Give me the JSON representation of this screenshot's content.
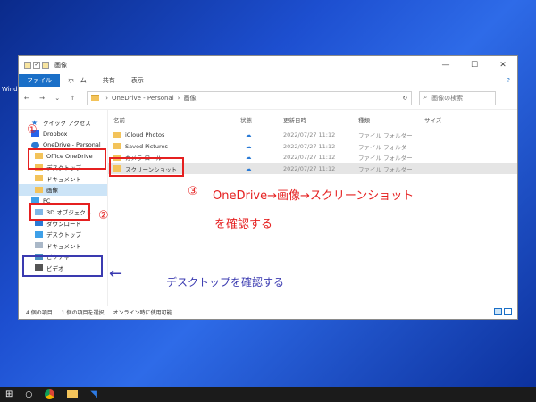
{
  "window": {
    "title": "画像",
    "controls": [
      "—",
      "☐",
      "✕"
    ]
  },
  "ribbon": {
    "tabs": [
      "ファイル",
      "ホーム",
      "共有",
      "表示"
    ],
    "help": "?"
  },
  "nav": {
    "back": "←",
    "forward": "→",
    "recent": "⌄",
    "up": "↑"
  },
  "address": {
    "segments": [
      "OneDrive - Personal",
      "画像"
    ],
    "separator": "›",
    "refresh": "↻"
  },
  "search": {
    "placeholder": "画像の検索",
    "icon": "⌕"
  },
  "sidebar": {
    "items": [
      {
        "label": "クイック アクセス",
        "icon": "star"
      },
      {
        "label": "Dropbox",
        "icon": "dropbox"
      },
      {
        "label": "OneDrive - Personal",
        "icon": "cloud"
      },
      {
        "label": "Office OneDrive",
        "icon": "folder"
      },
      {
        "label": "デスクトップ",
        "icon": "folder"
      },
      {
        "label": "ドキュメント",
        "icon": "folder"
      },
      {
        "label": "画像",
        "icon": "folder"
      },
      {
        "label": "PC",
        "icon": "pc"
      },
      {
        "label": "3D オブジェクト",
        "icon": "cube"
      },
      {
        "label": "ダウンロード",
        "icon": "download"
      },
      {
        "label": "デスクトップ",
        "icon": "desktop"
      },
      {
        "label": "ドキュメント",
        "icon": "doc"
      },
      {
        "label": "ピクチャ",
        "icon": "picture"
      },
      {
        "label": "ビデオ",
        "icon": "video"
      }
    ]
  },
  "columns": {
    "name": "名前",
    "status": "状態",
    "date": "更新日時",
    "type": "種類",
    "size": "サイズ"
  },
  "files": [
    {
      "name": "iCloud Photos",
      "status": "☁",
      "date": "2022/07/27 11:12",
      "type": "ファイル フォルダー"
    },
    {
      "name": "Saved Pictures",
      "status": "☁",
      "date": "2022/07/27 11:12",
      "type": "ファイル フォルダー"
    },
    {
      "name": "カメラ ロール",
      "status": "☁",
      "date": "2022/07/27 11:12",
      "type": "ファイル フォルダー"
    },
    {
      "name": "スクリーンショット",
      "status": "☁",
      "date": "2022/07/27 11:12",
      "type": "ファイル フォルダー"
    }
  ],
  "statusbar": {
    "count": "4 個の項目",
    "selected": "1 個の項目を選択",
    "availability": "オンライン時に使用可能"
  },
  "annotations": {
    "num1": "①",
    "num2": "②",
    "num3": "③",
    "instruction_line1": "OneDrive→画像→スクリーンショット",
    "instruction_line2": "を確認する",
    "desktop_arrow": "←",
    "desktop_note": "デスクトップを確認する"
  },
  "desktop": {
    "icon_label": "Windo"
  },
  "taskbar": {
    "start": "⊞",
    "search": "○"
  },
  "colors": {
    "accent": "#1a6fc7",
    "annotation_red": "#e52020",
    "annotation_blue": "#3a3ab0"
  }
}
